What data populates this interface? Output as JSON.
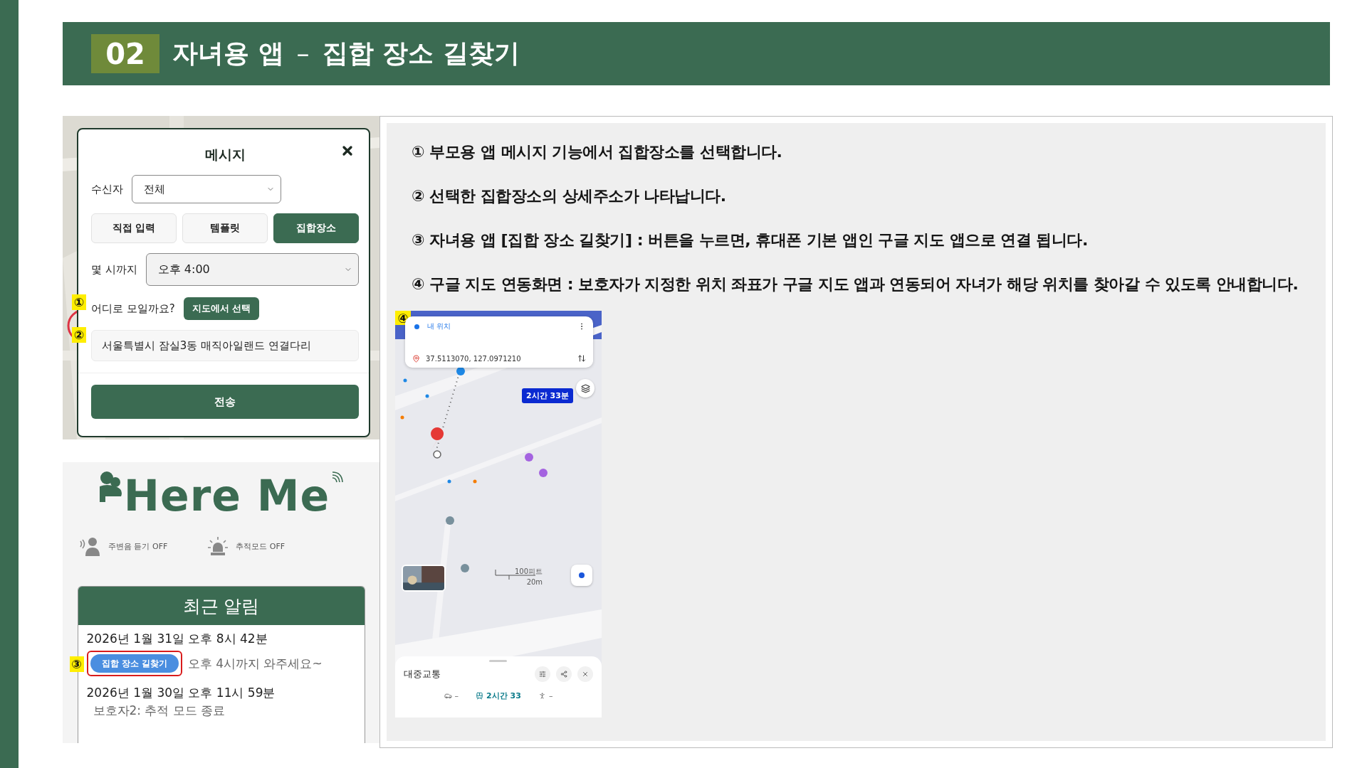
{
  "header": {
    "number": "02",
    "title": "자녀용 앱",
    "separator": "–",
    "subtitle": "집합 장소 길찾기"
  },
  "message_dialog": {
    "title": "메시지",
    "recipient": {
      "label": "수신자",
      "value": "전체"
    },
    "tabs": [
      {
        "label": "직접 입력",
        "selected": false
      },
      {
        "label": "템플릿",
        "selected": false
      },
      {
        "label": "집합장소",
        "selected": true
      }
    ],
    "time": {
      "label": "몇 시까지",
      "value": "오후 4:00"
    },
    "place": {
      "marker": "①",
      "question": "어디로 모일까요?",
      "button": "지도에서 선택"
    },
    "address": {
      "marker": "②",
      "value": "서울특별시 잠실3동 매직아일랜드 연결다리"
    },
    "submit": "전송"
  },
  "home": {
    "logo": "Here Me",
    "status": [
      {
        "kind": "listen",
        "label": "주변음 듣기 OFF"
      },
      {
        "kind": "siren",
        "label": "추적모드 OFF"
      }
    ],
    "alerts": {
      "title": "최근 알림",
      "items": [
        {
          "kind": "action",
          "time": "2026년 1월 31일 오후 8시 42분",
          "marker": "③",
          "button": "집합 장소 길찾기",
          "message": "오후 4시까지 와주세요~"
        },
        {
          "kind": "text",
          "time": "2026년 1월 30일 오후 11시 59분",
          "message": "보호자2: 추적 모드 종료"
        }
      ]
    }
  },
  "steps": [
    "① 부모용 앱 메시지 기능에서 집합장소를 선택합니다.",
    "② 선택한 집합장소의 상세주소가 나타납니다.",
    "③ 자녀용 앱 [집합 장소 길찾기]  : 버튼을 누르면, 휴대폰 기본 앱인 구글 지도 앱으로 연결 됩니다.",
    "④ 구글 지도 연동화면 : 보호자가 지정한 위치 좌표가 구글 지도 앱과 연동되어 자녀가 해당 위치를 찾아갈 수 있도록 안내합니다."
  ],
  "map": {
    "marker": "④",
    "origin": "내 위치",
    "destination": "37.5113070, 127.0971210",
    "duration": "2시간 33분",
    "scale": [
      "100피트",
      "20m"
    ],
    "sheet": {
      "title": "대중교통",
      "modes": [
        {
          "kind": "car",
          "label": "–",
          "selected": false
        },
        {
          "kind": "transit",
          "label": "2시간 33",
          "selected": true
        },
        {
          "kind": "walk",
          "label": "–",
          "selected": false
        }
      ]
    }
  }
}
